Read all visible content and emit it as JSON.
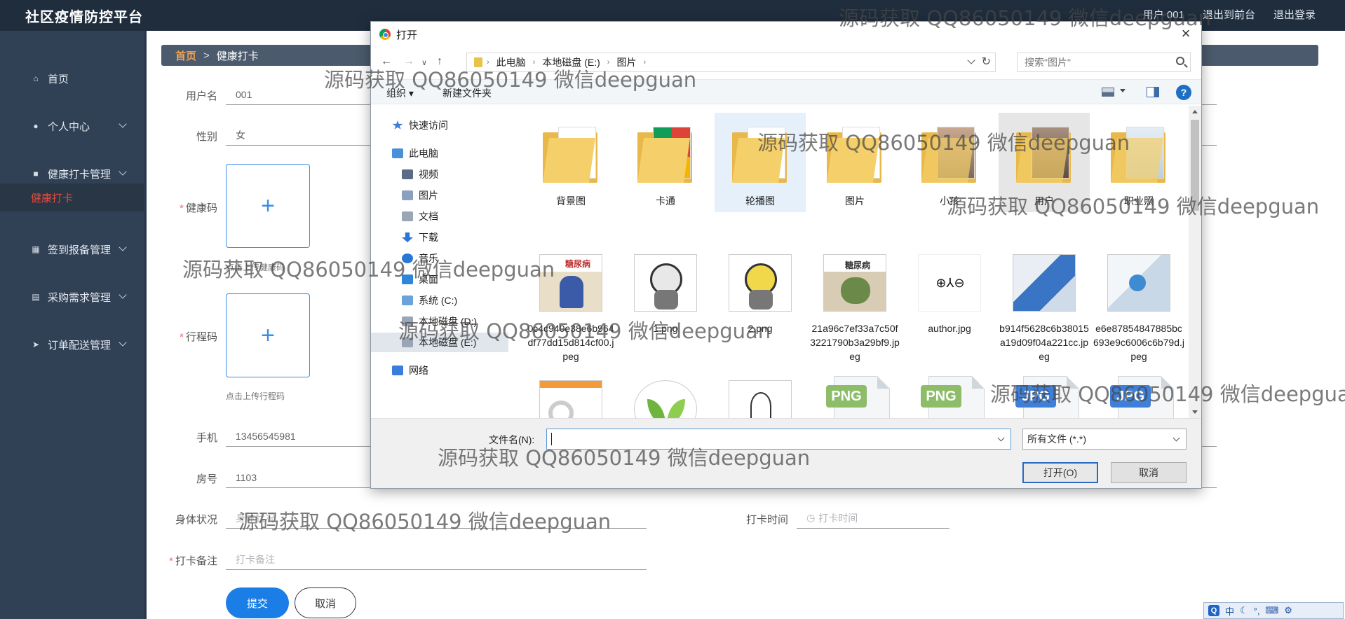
{
  "app": {
    "brand": "社区疫情防控平台",
    "top_links": [
      "用户 001",
      "退出到前台",
      "退出登录"
    ]
  },
  "sidebar": {
    "items": [
      {
        "label": "首页",
        "icon": "home-icon",
        "has_children": false
      },
      {
        "label": "个人中心",
        "icon": "user-icon",
        "has_children": true
      },
      {
        "label": "健康打卡管理",
        "icon": "briefcase-icon",
        "has_children": true
      },
      {
        "label": "签到报备管理",
        "icon": "grid-icon",
        "has_children": true
      },
      {
        "label": "采购需求管理",
        "icon": "clipboard-icon",
        "has_children": true
      },
      {
        "label": "订单配送管理",
        "icon": "send-icon",
        "has_children": true
      }
    ],
    "active_sub": "健康打卡"
  },
  "breadcrumb": {
    "home": "首页",
    "current": "健康打卡"
  },
  "form": {
    "username": {
      "label": "用户名",
      "value": "001"
    },
    "gender": {
      "label": "性别",
      "value": "女"
    },
    "health_code": {
      "label": "健康码",
      "hint": "点击上传健康码"
    },
    "trip_code": {
      "label": "行程码",
      "hint": "点击上传行程码"
    },
    "phone": {
      "label": "手机",
      "value": "13456545981"
    },
    "room": {
      "label": "房号",
      "value": "1103"
    },
    "body": {
      "label": "身体状况",
      "placeholder": "身体状况"
    },
    "checkin_time": {
      "label": "打卡时间",
      "placeholder": "打卡时间"
    },
    "remark": {
      "label": "打卡备注",
      "placeholder": "打卡备注"
    },
    "submit": "提交",
    "cancel": "取消"
  },
  "dialog": {
    "title": "打开",
    "close": "×",
    "path": [
      "此电脑",
      "本地磁盘 (E:)",
      "图片"
    ],
    "search_placeholder": "搜索\"图片\"",
    "organize": "组织 ▾",
    "new_folder": "新建文件夹",
    "help": "?",
    "nav": [
      {
        "label": "快速访问",
        "icon": "star-icon",
        "indent": 1,
        "color": "#3b7ddd"
      },
      {
        "label": "此电脑",
        "icon": "computer-icon",
        "indent": 1,
        "color": "#4a90d9"
      },
      {
        "label": "视频",
        "icon": "video-icon",
        "indent": 2,
        "color": "#5b6b85"
      },
      {
        "label": "图片",
        "icon": "picture-icon",
        "indent": 2,
        "color": "#8aa0bf"
      },
      {
        "label": "文档",
        "icon": "document-icon",
        "indent": 2,
        "color": "#9aa6b5"
      },
      {
        "label": "下载",
        "icon": "download-icon",
        "indent": 2,
        "color": "#2b78d4"
      },
      {
        "label": "音乐",
        "icon": "music-icon",
        "indent": 2,
        "color": "#2b78d4"
      },
      {
        "label": "桌面",
        "icon": "desktop-icon",
        "indent": 2,
        "color": "#2d86d8"
      },
      {
        "label": "系统 (C:)",
        "icon": "drive-c-icon",
        "indent": 2,
        "color": "#6aa3dc"
      },
      {
        "label": "本地磁盘 (D:)",
        "icon": "drive-d-icon",
        "indent": 2,
        "color": "#9aa6b5"
      },
      {
        "label": "本地磁盘 (E:)",
        "icon": "drive-e-icon",
        "indent": 2,
        "color": "#9aa6b5",
        "selected": true
      },
      {
        "label": "网络",
        "icon": "network-icon",
        "indent": 1,
        "color": "#3b7ddd"
      }
    ],
    "row1": [
      {
        "name": "背景图",
        "kind": "folder"
      },
      {
        "name": "卡通",
        "kind": "folder"
      },
      {
        "name": "轮播图",
        "kind": "folder"
      },
      {
        "name": "图片",
        "kind": "folder"
      },
      {
        "name": "小孩",
        "kind": "folder"
      },
      {
        "name": "用户",
        "kind": "folder"
      },
      {
        "name": "职业照",
        "kind": "folder"
      }
    ],
    "row2": [
      {
        "name": "0c4c940e38e6b964df77dd15d814cf00.jpeg",
        "kind": "image",
        "badge": "糖尿病",
        "tone": "#d9cfb8"
      },
      {
        "name": "1.png",
        "kind": "image",
        "tone": "#cccccc"
      },
      {
        "name": "2.png",
        "kind": "image",
        "tone": "#e8d64a"
      },
      {
        "name": "21a96c7ef33a7c50f3221790b3a29bf9.jpeg",
        "kind": "image",
        "badge": "糖尿病",
        "tone": "#c9b99a"
      },
      {
        "name": "author.jpg",
        "kind": "image",
        "badge": "⊕⅄⊖",
        "tone": "#ffffff"
      },
      {
        "name": "b914f5628c6b38015a19d09f04a221cc.jpeg",
        "kind": "image",
        "tone": "#4a82c8"
      },
      {
        "name": "e6e87854847885bc693e9c6006c6b79d.jpeg",
        "kind": "image",
        "tone": "#d9e4ef"
      }
    ],
    "row3": [
      {
        "kind": "image",
        "tone": "#f0f0f0"
      },
      {
        "kind": "image",
        "tone": "#7fbf4a"
      },
      {
        "kind": "image",
        "tone": "#ffffff"
      },
      {
        "kind": "file",
        "tag": "PNG",
        "tag_color": "#8ebd6a"
      },
      {
        "kind": "file",
        "tag": "PNG",
        "tag_color": "#8ebd6a"
      },
      {
        "kind": "file",
        "tag": "JPG",
        "tag_color": "#3f7fd8"
      },
      {
        "kind": "file",
        "tag": "JPG",
        "tag_color": "#3f7fd8"
      }
    ],
    "filename_label": "文件名(N):",
    "filename_value": "",
    "filetype": "所有文件 (*.*)",
    "open": "打开(O)",
    "cancel": "取消"
  },
  "watermarks": [
    "源码获取 QQ86050149 微信deepguan",
    "源码获取 QQ86050149 微信deepguan",
    "源码获取 QQ86050149 微信deepguan",
    "源码获取 QQ86050149 微信deepguan",
    "源码获取 QQ86050149 微信deepguan",
    "源码获取 QQ86050149 微信deepguan",
    "源码获取 QQ86050149 微信deepguan",
    "源码获取 QQ86050149 微信deepguan",
    "源码获取 QQ86050149 微信deepguan"
  ],
  "ime": {
    "label": "中"
  }
}
